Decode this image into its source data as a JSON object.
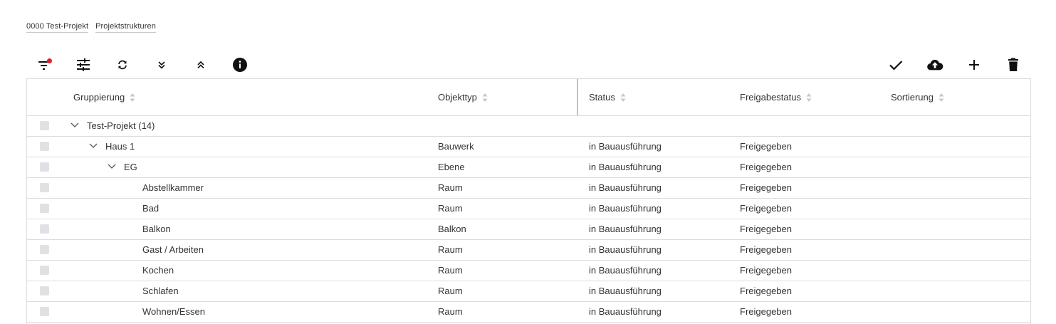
{
  "breadcrumb": {
    "items": [
      "0000 Test-Projekt",
      "Projektstrukturen"
    ]
  },
  "toolbar": {
    "left_icons": [
      "filter-icon",
      "tune-icon",
      "refresh-icon",
      "expand-all-icon",
      "collapse-all-icon",
      "info-icon"
    ],
    "right_icons": [
      "check-icon",
      "cloud-upload-icon",
      "add-icon",
      "delete-icon"
    ],
    "filter_active_color": "#e5202a"
  },
  "table": {
    "columns": [
      "Gruppierung",
      "Objekttyp",
      "Status",
      "Freigabestatus",
      "Sortierung"
    ],
    "rows": [
      {
        "level": 0,
        "expandable": true,
        "name": "Test-Projekt (14)",
        "type": "",
        "status": "",
        "release": "",
        "sort": ""
      },
      {
        "level": 1,
        "expandable": true,
        "name": "Haus 1",
        "type": "Bauwerk",
        "status": "in Bauausführung",
        "release": "Freigegeben",
        "sort": ""
      },
      {
        "level": 2,
        "expandable": true,
        "name": "EG",
        "type": "Ebene",
        "status": "in Bauausführung",
        "release": "Freigegeben",
        "sort": ""
      },
      {
        "level": 3,
        "expandable": false,
        "name": "Abstellkammer",
        "type": "Raum",
        "status": "in Bauausführung",
        "release": "Freigegeben",
        "sort": ""
      },
      {
        "level": 3,
        "expandable": false,
        "name": "Bad",
        "type": "Raum",
        "status": "in Bauausführung",
        "release": "Freigegeben",
        "sort": ""
      },
      {
        "level": 3,
        "expandable": false,
        "name": "Balkon",
        "type": "Balkon",
        "status": "in Bauausführung",
        "release": "Freigegeben",
        "sort": ""
      },
      {
        "level": 3,
        "expandable": false,
        "name": "Gast / Arbeiten",
        "type": "Raum",
        "status": "in Bauausführung",
        "release": "Freigegeben",
        "sort": ""
      },
      {
        "level": 3,
        "expandable": false,
        "name": "Kochen",
        "type": "Raum",
        "status": "in Bauausführung",
        "release": "Freigegeben",
        "sort": ""
      },
      {
        "level": 3,
        "expandable": false,
        "name": "Schlafen",
        "type": "Raum",
        "status": "in Bauausführung",
        "release": "Freigegeben",
        "sort": ""
      },
      {
        "level": 3,
        "expandable": false,
        "name": "Wohnen/Essen",
        "type": "Raum",
        "status": "in Bauausführung",
        "release": "Freigegeben",
        "sort": ""
      }
    ]
  }
}
